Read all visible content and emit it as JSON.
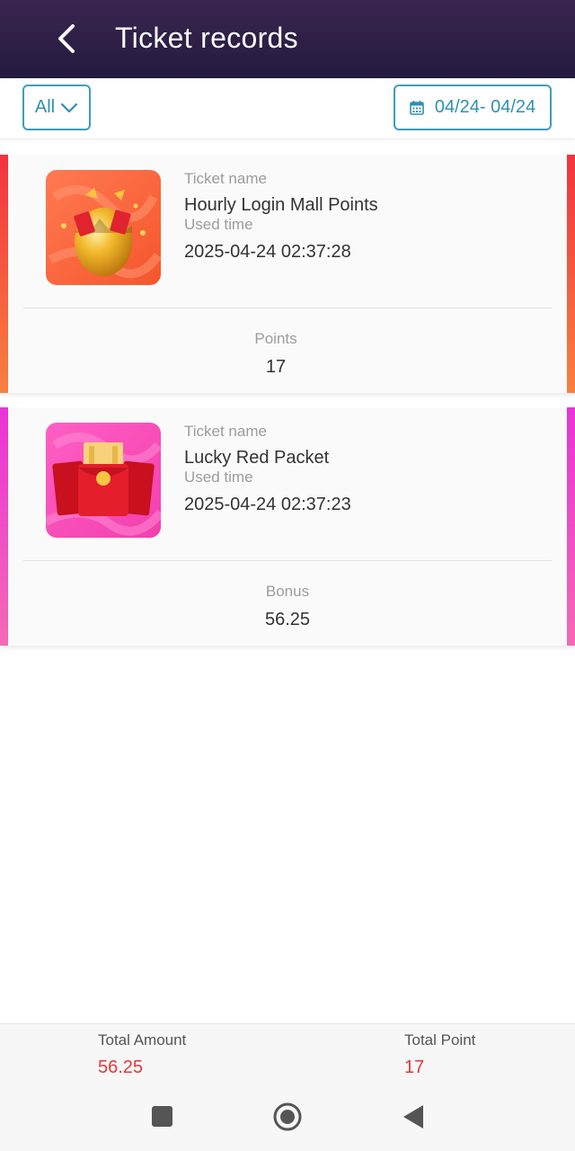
{
  "header": {
    "title": "Ticket records",
    "back_icon": "chevron-left-icon"
  },
  "filters": {
    "type_label": "All",
    "type_icon": "chevron-down-icon",
    "date_range": "04/24- 04/24",
    "date_icon": "calendar-icon"
  },
  "records": [
    {
      "icon": "golden-egg-icon",
      "name_label": "Ticket name",
      "name": "Hourly Login Mall Points",
      "time_label": "Used time",
      "time": "2025-04-24 02:37:28",
      "amount_label": "Points",
      "amount": "17",
      "accent": "#f04a3a"
    },
    {
      "icon": "red-packet-icon",
      "name_label": "Ticket name",
      "name": "Lucky Red Packet",
      "time_label": "Used time",
      "time": "2025-04-24 02:37:23",
      "amount_label": "Bonus",
      "amount": "56.25",
      "accent": "#ef3bd0"
    }
  ],
  "totals": {
    "amount_label": "Total Amount",
    "amount_value": "56.25",
    "point_label": "Total Point",
    "point_value": "17"
  },
  "system_nav": {
    "recent": "square-icon",
    "home": "circle-icon",
    "back": "triangle-back-icon"
  },
  "colors": {
    "accent_blue": "#3d9dbd",
    "total_red": "#e03a3a",
    "header_dark": "#2c1f45"
  }
}
